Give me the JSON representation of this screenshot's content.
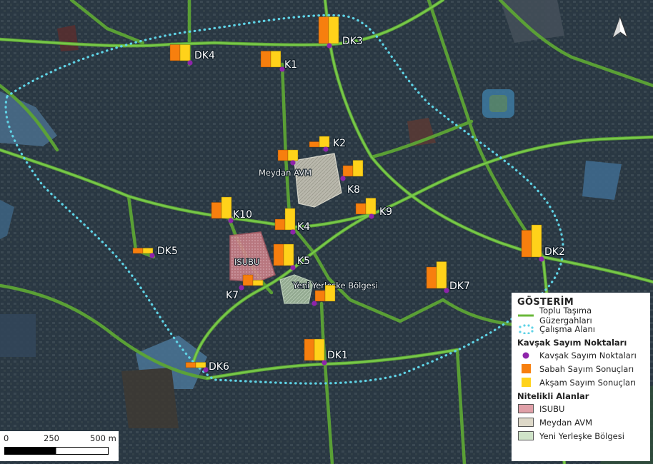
{
  "colors": {
    "route": "#6ab83a",
    "study_area": "#5fd3e6",
    "counting_point": "#8e24aa",
    "morning": "#f77f0e",
    "evening": "#ffd21a",
    "isubu_fill": "#e0a0a8",
    "meydan_fill": "#ddd8c8",
    "yerleske_fill": "#cfe3c8"
  },
  "north_arrow": {
    "icon": "north-arrow-icon"
  },
  "areas": [
    {
      "id": "isubu",
      "label": "ISUBU"
    },
    {
      "id": "meydan",
      "label": "Meydan AVM"
    },
    {
      "id": "yerleske",
      "label": "Yeni Yerleşke Bölgesi"
    }
  ],
  "points": [
    {
      "id": "DK3",
      "label": "DK3",
      "morning": 5,
      "evening": 5
    },
    {
      "id": "DK4",
      "label": "DK4",
      "morning": 3,
      "evening": 3
    },
    {
      "id": "K1",
      "label": "K1",
      "morning": 3,
      "evening": 3
    },
    {
      "id": "K2",
      "label": "K2",
      "morning": 1,
      "evening": 2
    },
    {
      "id": "K8",
      "label": "K8",
      "morning": 2,
      "evening": 3
    },
    {
      "id": "K9",
      "label": "K9",
      "morning": 2,
      "evening": 3
    },
    {
      "id": "K10",
      "label": "K10",
      "morning": 3,
      "evening": 4
    },
    {
      "id": "K4",
      "label": "K4",
      "morning": 2,
      "evening": 4
    },
    {
      "id": "K5",
      "label": "K5",
      "morning": 4,
      "evening": 4
    },
    {
      "id": "K7",
      "label": "K7",
      "morning": 2,
      "evening": 1
    },
    {
      "id": "K3",
      "label": "",
      "morning": 2,
      "evening": 3
    },
    {
      "id": "K6",
      "label": "",
      "morning": 2,
      "evening": 2
    },
    {
      "id": "DK5",
      "label": "DK5",
      "morning": 1,
      "evening": 1
    },
    {
      "id": "DK6",
      "label": "DK6",
      "morning": 1,
      "evening": 1
    },
    {
      "id": "DK1",
      "label": "DK1",
      "morning": 4,
      "evening": 4
    },
    {
      "id": "DK2",
      "label": "DK2",
      "morning": 5,
      "evening": 6
    },
    {
      "id": "DK7",
      "label": "DK7",
      "morning": 4,
      "evening": 5
    }
  ],
  "legend": {
    "title": "GÖSTERİM",
    "items1": [
      {
        "label": "Toplu Taşıma Güzergahları",
        "icon": "route-line-icon"
      },
      {
        "label": "Çalışma Alanı",
        "icon": "study-area-icon"
      }
    ],
    "section2_title": "Kavşak Sayım Noktaları",
    "items2": [
      {
        "label": "Kavşak Sayım Noktaları",
        "icon": "counting-point-icon"
      },
      {
        "label": "Sabah Sayım Sonuçları",
        "icon": "morning-square-icon"
      },
      {
        "label": "Akşam  Sayım Sonuçları",
        "icon": "evening-square-icon"
      }
    ],
    "section3_title": "Nitelikli Alanlar",
    "items3": [
      {
        "label": "ISUBU",
        "icon": "isubu-swatch-icon"
      },
      {
        "label": "Meydan AVM",
        "icon": "meydan-swatch-icon"
      },
      {
        "label": "Yeni Yerleşke Bölgesi",
        "icon": "yerleske-swatch-icon"
      }
    ]
  },
  "scalebar": {
    "t0": "0",
    "t1": "250",
    "t2": "500 m"
  }
}
